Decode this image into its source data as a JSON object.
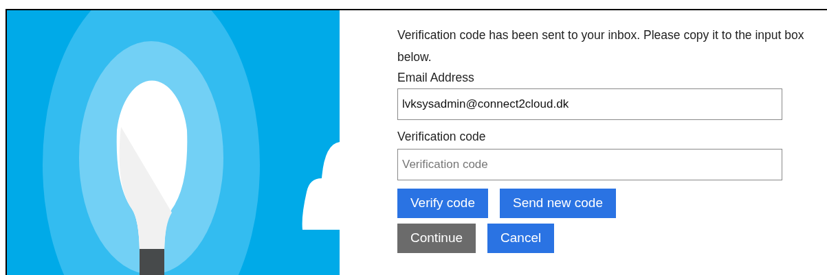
{
  "message": "Verification code has been sent to your inbox. Please copy it to the input box below.",
  "email_field": {
    "label": "Email Address",
    "value": "lvksysadmin@connect2cloud.dk"
  },
  "code_field": {
    "label": "Verification code",
    "placeholder": "Verification code"
  },
  "button_rows": [
    [
      {
        "label": "Verify code",
        "disabled": false
      },
      {
        "label": "Send new code",
        "disabled": false
      }
    ],
    [
      {
        "label": "Continue",
        "disabled": true
      },
      {
        "label": "Cancel",
        "disabled": false
      }
    ]
  ]
}
